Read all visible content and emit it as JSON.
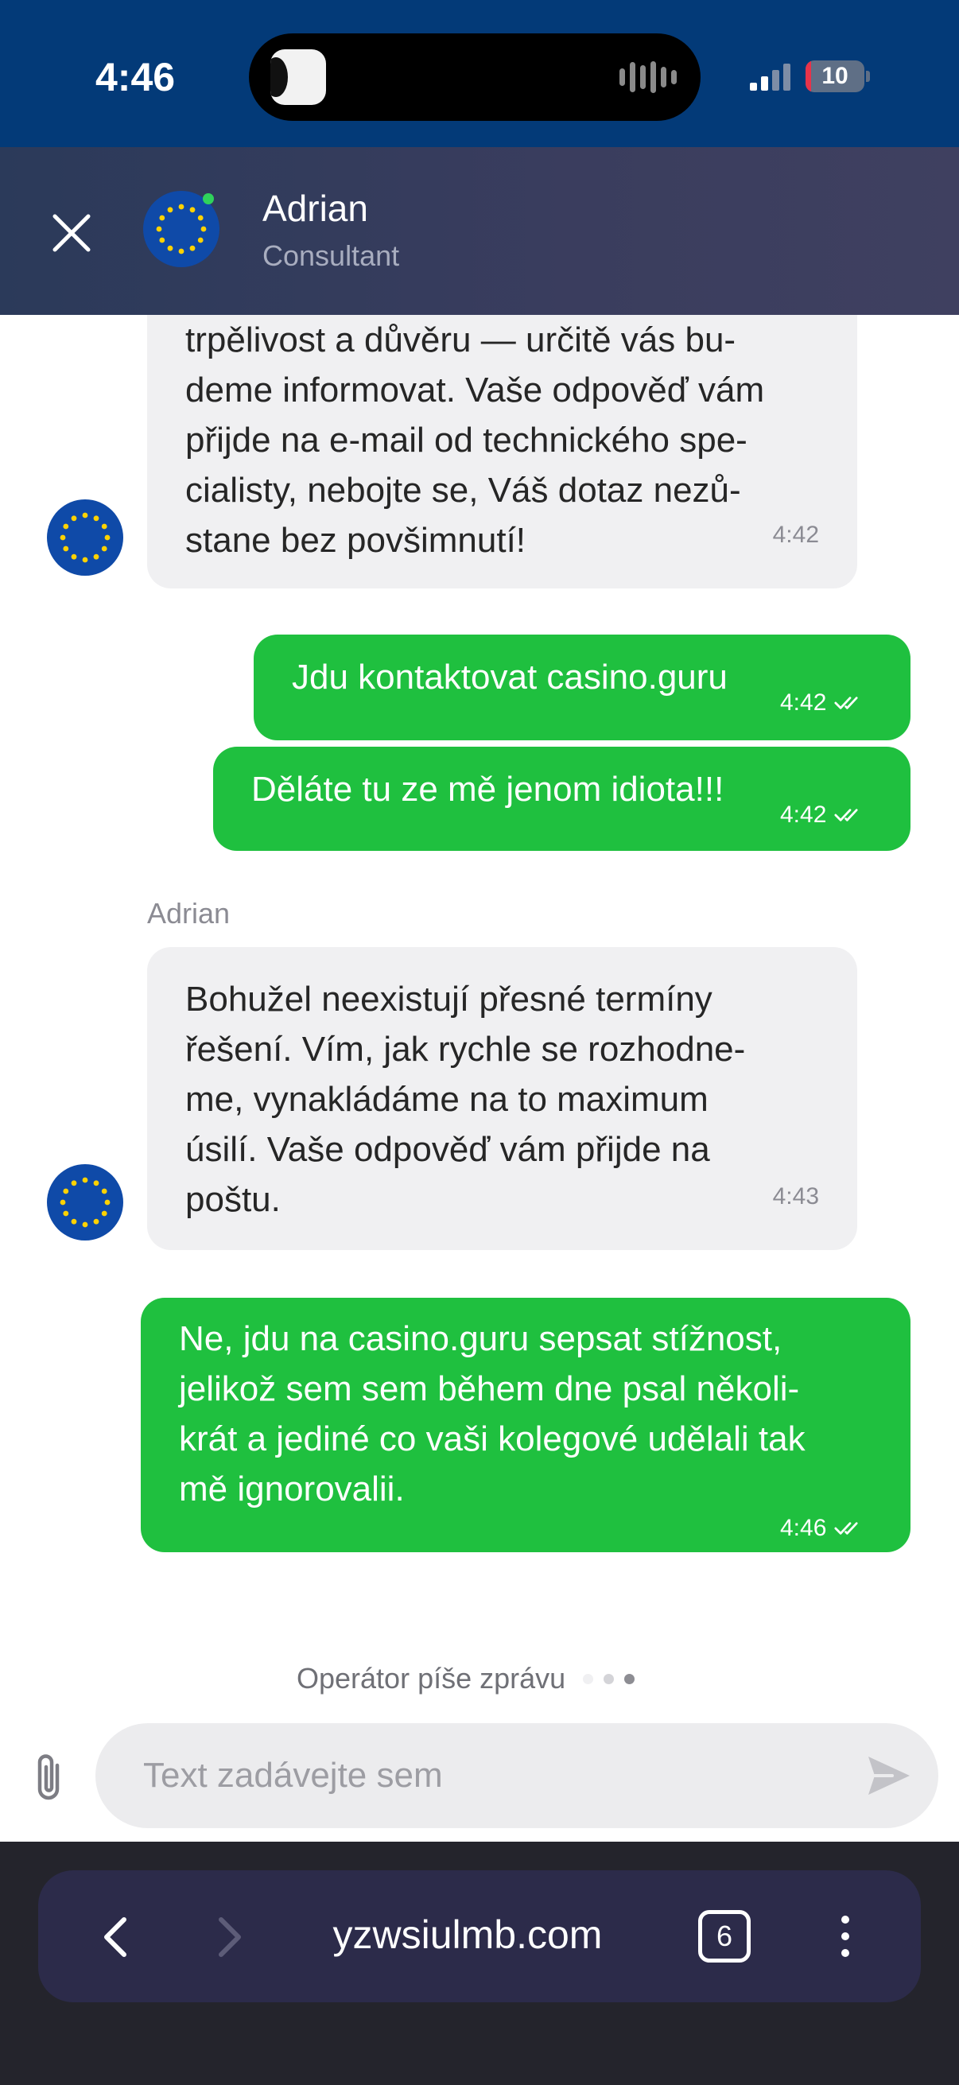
{
  "status_bar": {
    "time": "4:46",
    "battery": "10",
    "battery_percent": 10,
    "icons": [
      "dynamic-island-app-icon",
      "audio-wave-icon",
      "signal-icon",
      "battery-icon"
    ]
  },
  "header": {
    "agent_name": "Adrian",
    "agent_role": "Consultant",
    "icons": [
      "close-icon",
      "eu-flag-avatar",
      "online-status-dot"
    ]
  },
  "messages": [
    {
      "direction": "in",
      "lines": [
        "trpělivost a důvěru — určitě vás bu-",
        "deme informovat. Vaše odpověď vám",
        "přijde na e-mail od technického spe-",
        "cialisty, nebojte se, Váš dotaz nezů-",
        "stane bez povšimnutí!"
      ],
      "time": "4:42"
    },
    {
      "direction": "out",
      "text": "Jdu kontaktovat casino.guru",
      "time": "4:42"
    },
    {
      "direction": "out",
      "text": "Děláte tu ze mě jenom idiota!!!",
      "time": "4:42"
    },
    {
      "direction": "in",
      "sender": "Adrian",
      "lines": [
        "Bohužel neexistují přesné termíny",
        "řešení.  Vím, jak rychle se rozhodne-",
        "me, vynakládáme na to maximum",
        "úsilí. Vaše odpověď vám přijde na",
        "poštu."
      ],
      "time": "4:43"
    },
    {
      "direction": "out",
      "lines": [
        "Ne, jdu na casino.guru sepsat stížnost,",
        "jelikož sem sem během dne psal několi-",
        "krát a jediné co vaši kolegové udělali tak",
        "mě ignorovalii."
      ],
      "time": "4:46"
    }
  ],
  "typing_indicator": "Operátor píše zprávu",
  "composer": {
    "placeholder": "Text zadávejte sem",
    "icons": [
      "paperclip-icon",
      "send-icon"
    ]
  },
  "browser": {
    "url": "yzwsiulmb.com",
    "tab_count": "6",
    "icons": [
      "back-icon",
      "forward-icon",
      "more-icon"
    ]
  },
  "colors": {
    "status_bar": "#033a78",
    "header": "#2b3a5a",
    "incoming_bubble": "#f0f0f2",
    "outgoing_bubble": "#1fc03f",
    "browser_bar": "#2c2b4a"
  }
}
